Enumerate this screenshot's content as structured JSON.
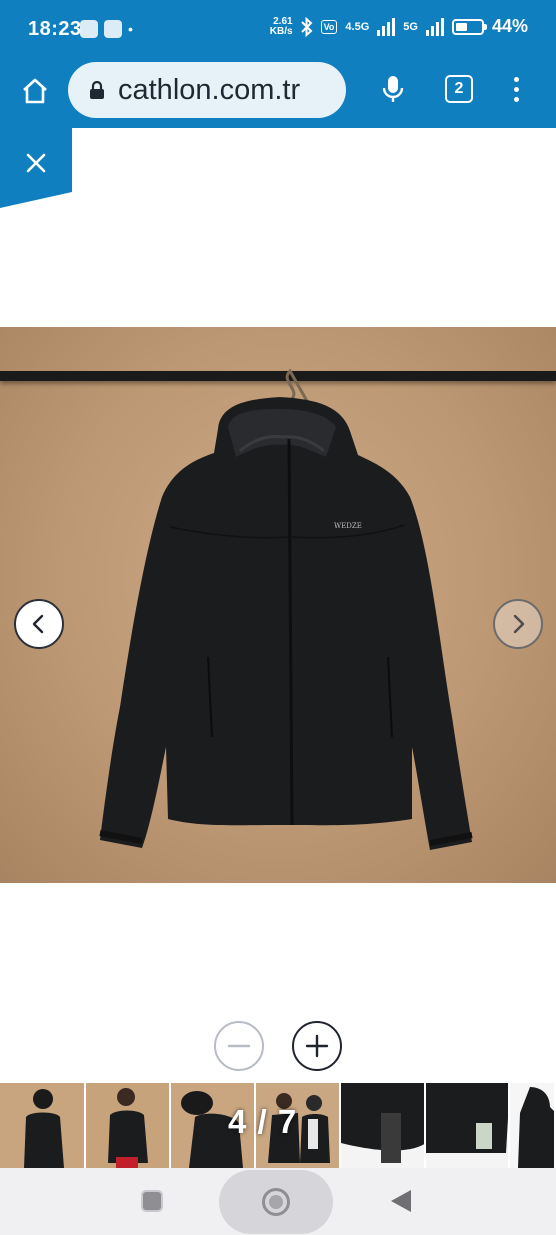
{
  "status_bar": {
    "time": "18:23",
    "net_speed_value": "2.61",
    "net_speed_unit": "KB/s",
    "network_type_1": "4.5G",
    "network_type_2": "5G",
    "battery_percent": "44%",
    "battery_level": 0.44
  },
  "browser": {
    "url": "cathlon.com.tr",
    "tab_count": "2"
  },
  "gallery": {
    "counter": "4 / 7",
    "current_index": 4,
    "total": 7,
    "logo_text": "WEDZE"
  },
  "colors": {
    "brand_blue": "#0f7fc0",
    "jacket": "#1b1c1e",
    "backdrop": "#c2a07d"
  },
  "icons": {
    "home": "home-icon",
    "lock": "lock-icon",
    "mic": "microphone-icon",
    "menu": "more-vert-icon",
    "close": "close-icon",
    "prev": "chevron-left-icon",
    "next": "chevron-right-icon",
    "zoom_out": "minus-icon",
    "zoom_in": "plus-icon"
  }
}
